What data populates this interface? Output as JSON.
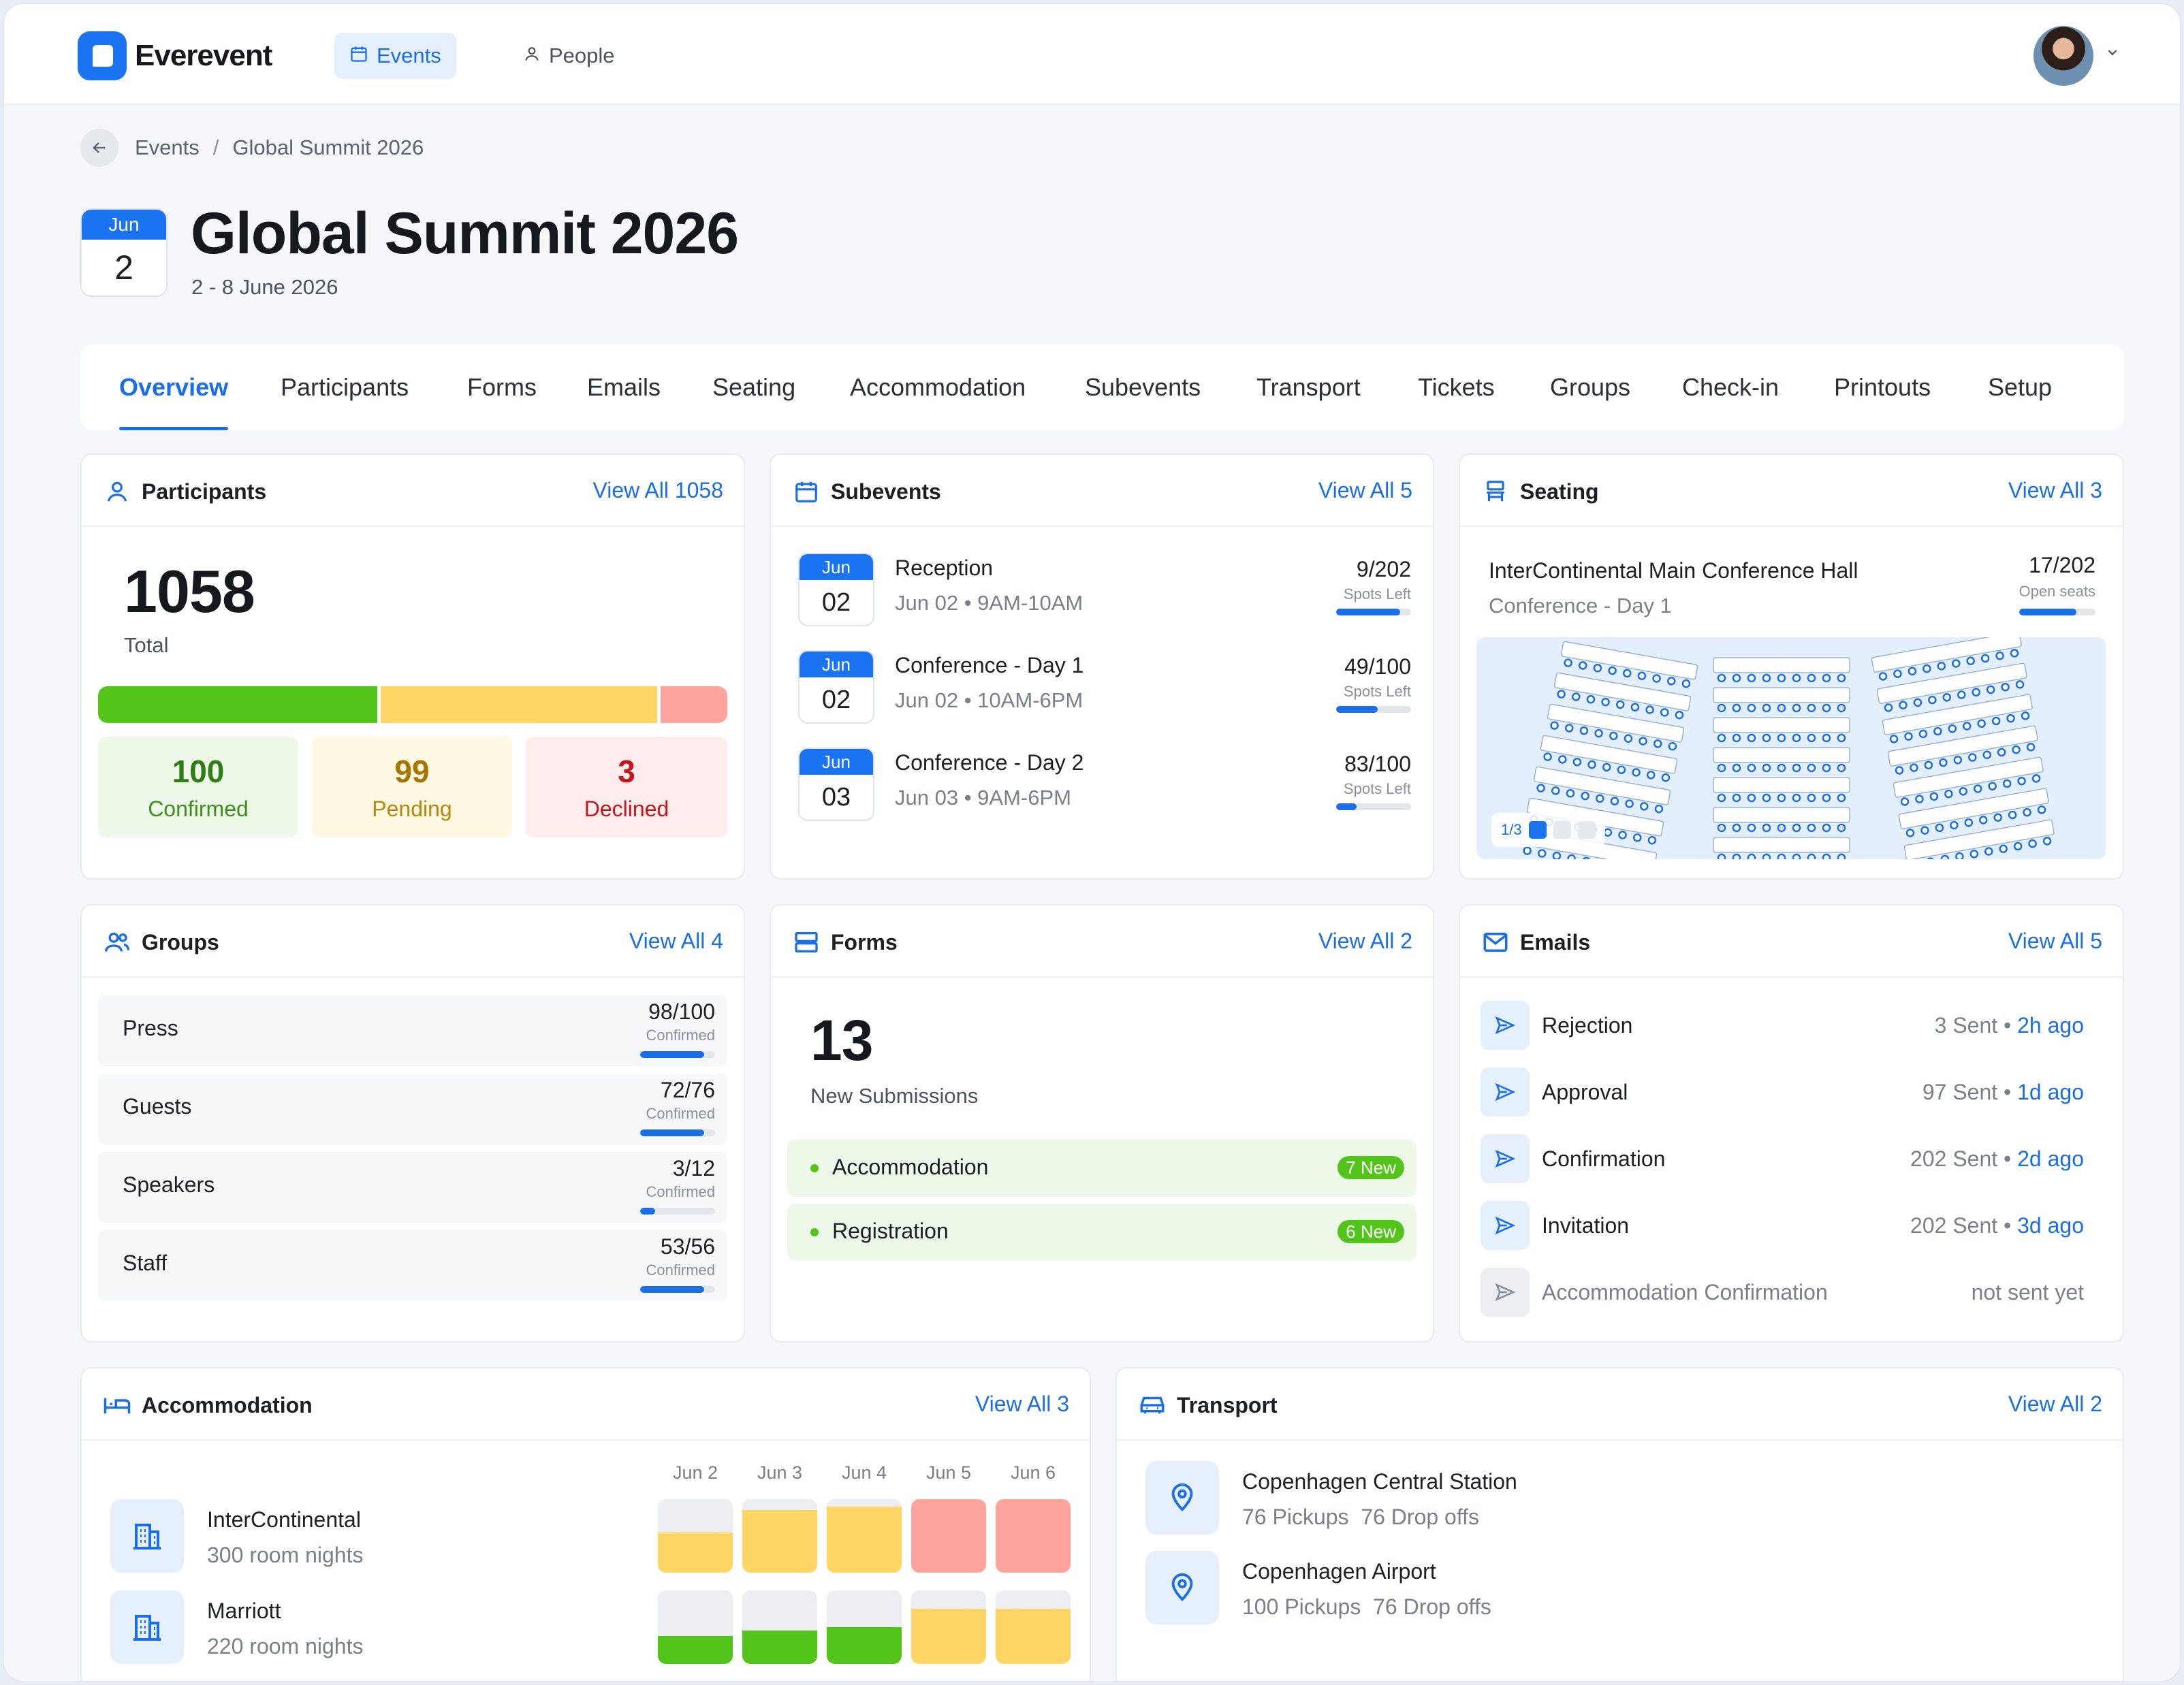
{
  "app": {
    "name": "Everevent"
  },
  "nav": {
    "items": [
      {
        "label": "Events",
        "icon": "calendar-icon",
        "active": true
      },
      {
        "label": "People",
        "icon": "person-icon",
        "active": false
      }
    ]
  },
  "breadcrumb": {
    "items": [
      "Events",
      "Global Summit 2026"
    ]
  },
  "event": {
    "month": "Jun",
    "day": "2",
    "title": "Global Summit 2026",
    "dates": "2 - 8 June 2026"
  },
  "tabs": [
    "Overview",
    "Participants",
    "Forms",
    "Emails",
    "Seating",
    "Accommodation",
    "Subevents",
    "Transport",
    "Tickets",
    "Groups",
    "Check-in",
    "Printouts",
    "Setup"
  ],
  "participants": {
    "title": "Participants",
    "link": "View All 1058",
    "total": "1058",
    "total_label": "Total",
    "confirmed": {
      "value": "100",
      "label": "Confirmed"
    },
    "pending": {
      "value": "99",
      "label": "Pending"
    },
    "declined": {
      "value": "3",
      "label": "Declined"
    }
  },
  "subevents": {
    "title": "Subevents",
    "link": "View All 5",
    "items": [
      {
        "month": "Jun",
        "day": "02",
        "name": "Reception",
        "time": "Jun 02 • 9AM-10AM",
        "count": "9/202",
        "note": "Spots Left",
        "fill": 0.85
      },
      {
        "month": "Jun",
        "day": "02",
        "name": "Conference - Day 1",
        "time": "Jun 02 • 10AM-6PM",
        "count": "49/100",
        "note": "Spots Left",
        "fill": 0.55
      },
      {
        "month": "Jun",
        "day": "03",
        "name": "Conference - Day 2",
        "time": "Jun 03 • 9AM-6PM",
        "count": "83/100",
        "note": "Spots Left",
        "fill": 0.27
      }
    ]
  },
  "seating": {
    "title": "Seating",
    "link": "View All 3",
    "hall": "InterContinental Main Conference Hall",
    "session": "Conference - Day 1",
    "count": "17/202",
    "note": "Open seats",
    "fill": 0.75,
    "pager": "1/3"
  },
  "groups": {
    "title": "Groups",
    "link": "View All 4",
    "items": [
      {
        "name": "Press",
        "count": "98/100",
        "note": "Confirmed",
        "fill": 0.85
      },
      {
        "name": "Guests",
        "count": "72/76",
        "note": "Confirmed",
        "fill": 0.85
      },
      {
        "name": "Speakers",
        "count": "3/12",
        "note": "Confirmed",
        "fill": 0.2
      },
      {
        "name": "Staff",
        "count": "53/56",
        "note": "Confirmed",
        "fill": 0.85
      }
    ]
  },
  "forms": {
    "title": "Forms",
    "link": "View All 2",
    "count": "13",
    "label": "New Submissions",
    "items": [
      {
        "name": "Accommodation",
        "badge": "7 New"
      },
      {
        "name": "Registration",
        "badge": "6 New"
      }
    ]
  },
  "emails": {
    "title": "Emails",
    "link": "View All 5",
    "items": [
      {
        "name": "Rejection",
        "sent": "3 Sent",
        "ago": "2h ago"
      },
      {
        "name": "Approval",
        "sent": "97 Sent",
        "ago": "1d ago"
      },
      {
        "name": "Confirmation",
        "sent": "202 Sent",
        "ago": "2d ago"
      },
      {
        "name": "Invitation",
        "sent": "202 Sent",
        "ago": "3d ago"
      },
      {
        "name": "Accommodation Confirmation",
        "status": "not sent yet"
      }
    ]
  },
  "accommodation": {
    "title": "Accommodation",
    "link": "View All 3",
    "days": [
      "Jun 2",
      "Jun 3",
      "Jun 4",
      "Jun 5",
      "Jun 6"
    ],
    "hotels": [
      {
        "name": "InterContinental",
        "nights": "300 room nights",
        "occupancy": [
          0.55,
          0.85,
          0.9,
          1.0,
          1.0
        ],
        "colors": [
          "#ffd666",
          "#ffd666",
          "#ffd666",
          "#ffa39e",
          "#ffa39e"
        ]
      },
      {
        "name": "Marriott",
        "nights": "220 room nights",
        "occupancy": [
          0.38,
          0.45,
          0.5,
          0.75,
          0.75
        ],
        "colors": [
          "#52c41a",
          "#52c41a",
          "#52c41a",
          "#ffd666",
          "#ffd666"
        ]
      }
    ]
  },
  "transport": {
    "title": "Transport",
    "link": "View All 2",
    "items": [
      {
        "name": "Copenhagen Central Station",
        "pickups": "76 Pickups",
        "dropoffs": "76 Drop offs"
      },
      {
        "name": "Copenhagen Airport",
        "pickups": "100 Pickups",
        "dropoffs": "76 Drop offs"
      }
    ]
  },
  "colors": {
    "accent": "#1a6fe8",
    "confirmed": "#52c41a",
    "pending": "#ffd666",
    "declined": "#ffa39e"
  }
}
